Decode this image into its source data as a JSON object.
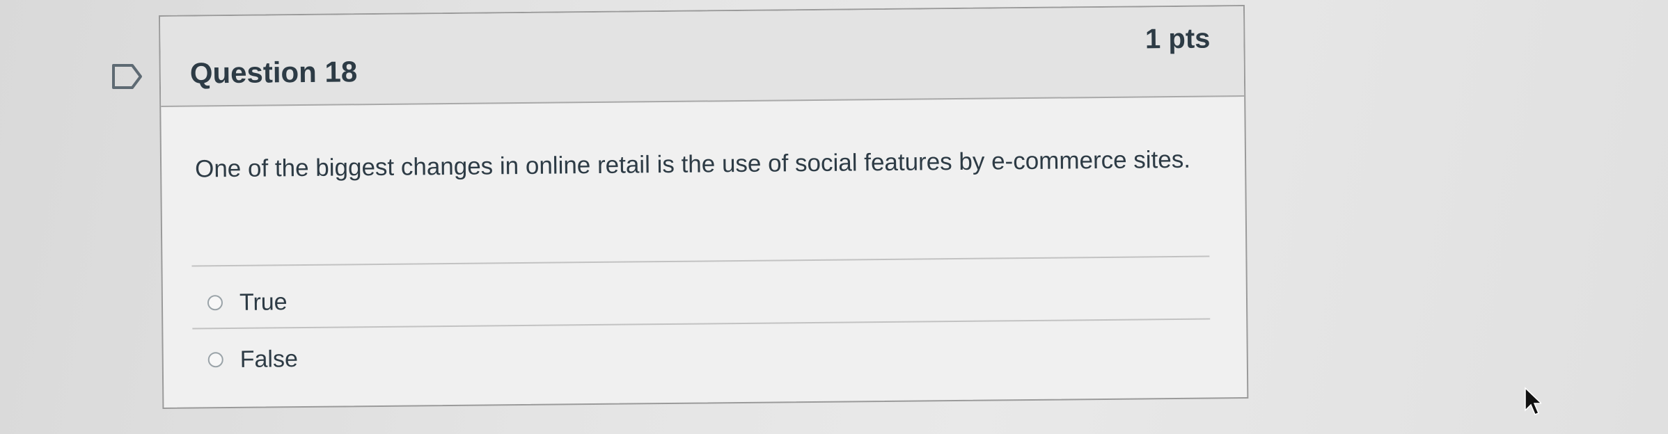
{
  "question": {
    "title": "Question 18",
    "points": "1 pts",
    "text": "One of the biggest changes in online retail is the use of social features by e-commerce sites.",
    "answers": [
      {
        "label": "True",
        "selected": false
      },
      {
        "label": "False",
        "selected": false
      }
    ]
  },
  "icons": {
    "flag": "flag-outline-icon",
    "cursor": "mouse-pointer-icon"
  },
  "colors": {
    "text": "#2d3b45",
    "header_bg": "#e3e3e3",
    "card_bg": "#f0f0f0",
    "border": "#9a9a9a"
  }
}
